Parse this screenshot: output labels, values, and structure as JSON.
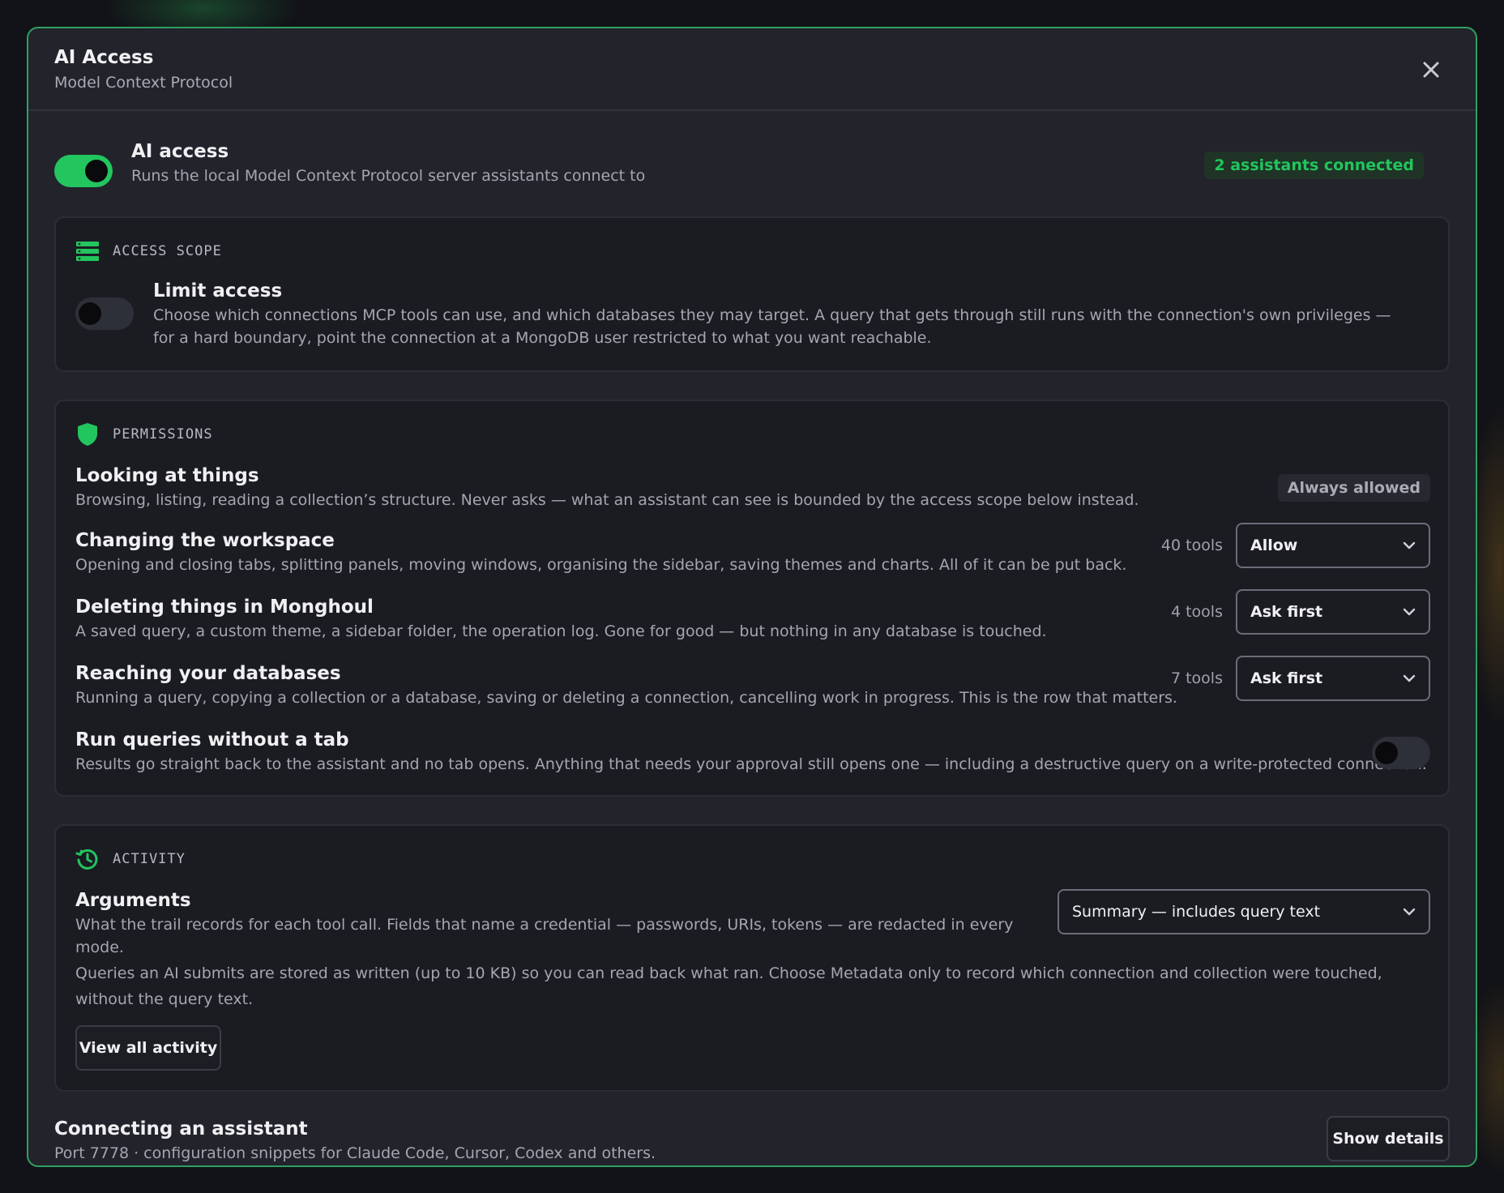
{
  "modal": {
    "title": "AI Access",
    "subtitle": "Model Context Protocol"
  },
  "master": {
    "title": "AI access",
    "desc": "Runs the local Model Context Protocol server assistants connect to",
    "enabled": true,
    "badge": "2 assistants connected"
  },
  "scope": {
    "label": "ACCESS SCOPE",
    "title": "Limit access",
    "desc": "Choose which connections MCP tools can use, and which databases they may target. A query that gets through still runs with the connection's own privileges — for a hard boundary, point the connection at a MongoDB user restricted to what you want reachable.",
    "enabled": false
  },
  "permissions": {
    "label": "PERMISSIONS",
    "rows": [
      {
        "title": "Looking at things",
        "desc": "Browsing, listing, reading a collection’s structure. Never asks — what an assistant can see is bounded by the access scope below instead.",
        "badge": "Always allowed"
      },
      {
        "title": "Changing the workspace",
        "desc": "Opening and closing tabs, splitting panels, moving windows, organising the sidebar, saving themes and charts. All of it can be put back.",
        "tools": "40 tools",
        "value": "Allow"
      },
      {
        "title": "Deleting things in Monghoul",
        "desc": "A saved query, a custom theme, a sidebar folder, the operation log. Gone for good — but nothing in any database is touched.",
        "tools": "4 tools",
        "value": "Ask first"
      },
      {
        "title": "Reaching your databases",
        "desc": "Running a query, copying a collection or a database, saving or deleting a connection, cancelling work in progress. This is the row that matters.",
        "tools": "7 tools",
        "value": "Ask first"
      },
      {
        "title": "Run queries without a tab",
        "desc": "Results go straight back to the assistant and no tab opens. Anything that needs your approval still opens one — including a destructive query on a write-protected connection.",
        "enabled": false
      }
    ]
  },
  "activity": {
    "label": "ACTIVITY",
    "title": "Arguments",
    "desc": "What the trail records for each tool call. Fields that name a credential — passwords, URIs, tokens — are redacted in every mode.",
    "value": "Summary — includes query text",
    "note": "Queries an AI submits are stored as written (up to 10 KB) so you can read back what ran. Choose Metadata only to record which connection and collection were touched, without the query text.",
    "button": "View all activity"
  },
  "connect": {
    "title": "Connecting an assistant",
    "desc": "Port 7778 · configuration snippets for Claude Code, Cursor, Codex and others.",
    "button": "Show details"
  },
  "colors": {
    "accent": "#22c55e",
    "border": "#2f9f62",
    "bg": "#22232b"
  },
  "icons": {
    "close": "close-icon",
    "scope": "database-icon",
    "permissions": "shield-icon",
    "activity": "history-icon",
    "chevron": "chevron-down-icon"
  }
}
